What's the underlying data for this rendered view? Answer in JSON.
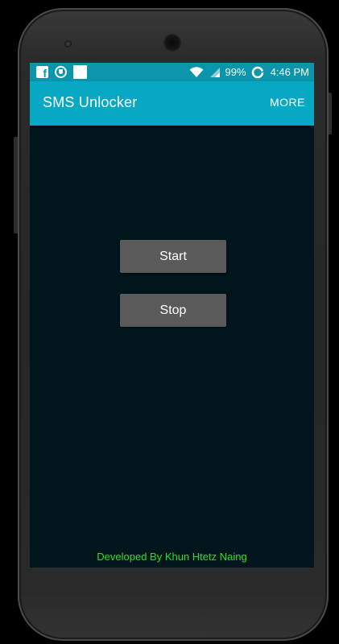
{
  "status_bar": {
    "battery": "99%",
    "time": "4:46 PM",
    "left_icons": [
      "facebook-icon",
      "shield-icon",
      "blank-notification-icon"
    ],
    "right_icons": [
      "wifi-icon",
      "cell-signal-icon",
      "battery-ring-icon"
    ]
  },
  "app_bar": {
    "title": "SMS Unlocker",
    "more_label": "MORE"
  },
  "main": {
    "start_label": "Start",
    "stop_label": "Stop"
  },
  "footer": {
    "credit": "Developed By Khun Htetz Naing"
  },
  "colors": {
    "status_bar": "#0a95aa",
    "app_bar": "#07a8c4",
    "background": "#01151c",
    "button": "#5a5a5a",
    "footer_text": "#23e61f"
  }
}
